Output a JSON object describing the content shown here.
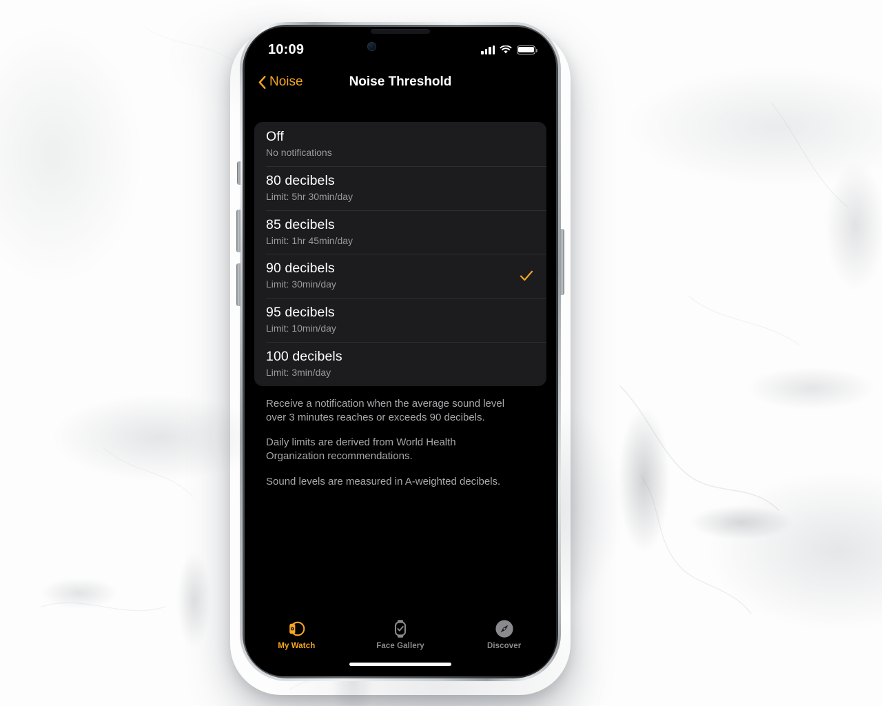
{
  "status_bar": {
    "time": "10:09",
    "cellular_icon": "cellular-bars-icon",
    "wifi_icon": "wifi-icon",
    "battery_icon": "battery-full-icon"
  },
  "nav_bar": {
    "back_label": "Noise",
    "back_icon": "chevron-left-icon",
    "title": "Noise Threshold"
  },
  "options": [
    {
      "title": "Off",
      "subtitle": "No notifications",
      "selected": false
    },
    {
      "title": "80 decibels",
      "subtitle": "Limit: 5hr 30min/day",
      "selected": false
    },
    {
      "title": "85 decibels",
      "subtitle": "Limit: 1hr 45min/day",
      "selected": false
    },
    {
      "title": "90 decibels",
      "subtitle": "Limit: 30min/day",
      "selected": true
    },
    {
      "title": "95 decibels",
      "subtitle": "Limit: 10min/day",
      "selected": false
    },
    {
      "title": "100 decibels",
      "subtitle": "Limit: 3min/day",
      "selected": false
    }
  ],
  "footnotes": [
    "Receive a notification when the average sound level over 3 minutes reaches or exceeds 90 decibels.",
    "Daily limits are derived from World Health Organization recommendations.",
    "Sound levels are measured in A-weighted decibels."
  ],
  "tab_bar": [
    {
      "label": "My Watch",
      "icon": "watch-side-icon",
      "active": true
    },
    {
      "label": "Face Gallery",
      "icon": "watch-face-icon",
      "active": false
    },
    {
      "label": "Discover",
      "icon": "compass-icon",
      "active": false
    }
  ],
  "colors": {
    "accent": "#F5A623",
    "screen_background": "#000000",
    "card_background": "#1C1C1E",
    "primary_text": "#FFFFFF",
    "secondary_text": "#9A9A9E",
    "separator": "#2E2E30",
    "inactive_tab": "#8A8A8E"
  }
}
